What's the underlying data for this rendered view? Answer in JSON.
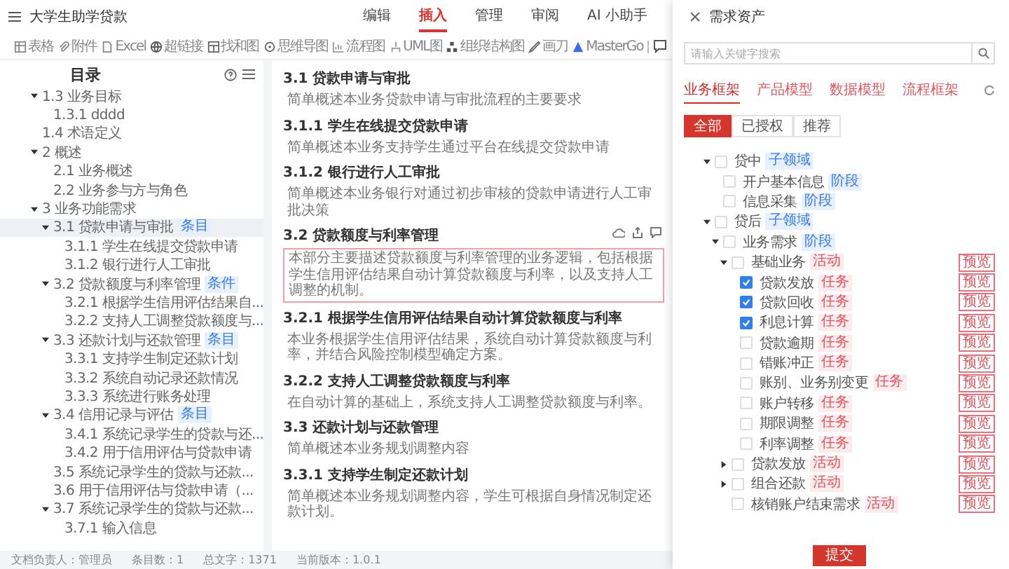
{
  "app": {
    "title": "大学生助学贷款"
  },
  "menu_tabs": [
    {
      "label": "编辑",
      "selected": false
    },
    {
      "label": "插入",
      "selected": true
    },
    {
      "label": "管理",
      "selected": false
    },
    {
      "label": "审阅",
      "selected": false
    },
    {
      "label": "AI 小助手",
      "selected": false
    }
  ],
  "toolbar": [
    {
      "kind": "table",
      "label": "表格"
    },
    {
      "kind": "attachment",
      "label": "附件"
    },
    {
      "kind": "excel",
      "label": "Excel"
    },
    {
      "kind": "link",
      "label": "超链接"
    },
    {
      "kind": "chart",
      "label": "找和图"
    },
    {
      "kind": "mindmap",
      "label": "思维导图"
    },
    {
      "kind": "flow",
      "label": "流程图"
    },
    {
      "kind": "uml",
      "label": "UML图"
    },
    {
      "kind": "org",
      "label": "组织结构图"
    },
    {
      "kind": "pen",
      "label": "画刀"
    },
    {
      "kind": "mastergo",
      "label": "MasterGo"
    }
  ],
  "outline": {
    "title": "目录",
    "items": [
      {
        "label": "1.3 业务目标",
        "expanded": true,
        "selected": false,
        "children": [
          {
            "label": "1.3.1 dddd",
            "selected": false
          }
        ]
      },
      {
        "label": "1.4 术语定义",
        "selected": false
      },
      {
        "label": "2 概述",
        "expanded": true,
        "selected": false,
        "children": [
          {
            "label": "2.1 业务概述",
            "selected": false
          },
          {
            "label": "2.2 业务参与方与角色",
            "selected": false
          }
        ]
      },
      {
        "label": "3 业务功能需求",
        "expanded": true,
        "selected": false,
        "children": [
          {
            "label": "3.1 贷款申请与审批",
            "tag": "条目",
            "expanded": true,
            "selected": true,
            "children": [
              {
                "label": "3.1.1 学生在线提交贷款申请",
                "selected": false
              },
              {
                "label": "3.1.2 银行进行人工审批",
                "selected": false
              }
            ]
          },
          {
            "label": "3.2 贷款额度与利率管理",
            "tag": "条件",
            "expanded": true,
            "selected": false,
            "children": [
              {
                "label": "3.2.1 根据学生信用评估结果自...",
                "selected": false
              },
              {
                "label": "3.2.2 支持人工调整贷款额度与...",
                "selected": false
              }
            ]
          },
          {
            "label": "3.3 还款计划与还款管理",
            "tag": "条目",
            "expanded": true,
            "selected": false,
            "children": [
              {
                "label": "3.3.1 支持学生制定还款计划",
                "selected": false
              },
              {
                "label": "3.3.2 系统自动记录还款情况",
                "selected": false
              },
              {
                "label": "3.3.3 系统进行账务处理",
                "selected": false
              }
            ]
          },
          {
            "label": "3.4 信用记录与评估",
            "tag": "条目",
            "expanded": true,
            "selected": false,
            "children": [
              {
                "label": "3.4.1 系统记录学生的贷款与还...",
                "selected": false
              },
              {
                "label": "3.4.2 用于信用评估与贷款申请",
                "selected": false
              }
            ]
          },
          {
            "label": "3.5 系统记录学生的贷款与还款...",
            "selected": false
          },
          {
            "label": "3.6 用于信用评估与贷款申请（...",
            "selected": false
          },
          {
            "label": "3.7 系统记录学生的贷款与还款...",
            "expanded": true,
            "selected": false,
            "children": [
              {
                "label": "3.7.1 输入信息",
                "selected": false
              }
            ]
          }
        ]
      }
    ]
  },
  "document": {
    "blocks": [
      {
        "kind": "heading",
        "text": "3.1 贷款申请与审批",
        "selected": false
      },
      {
        "kind": "paragraph",
        "text": "简单概述本业务贷款申请与审批流程的主要要求",
        "selected": false
      },
      {
        "kind": "heading",
        "text": "3.1.1 学生在线提交贷款申请",
        "selected": false
      },
      {
        "kind": "paragraph",
        "text": "简单概述本业务支持学生通过平台在线提交贷款申请",
        "selected": false
      },
      {
        "kind": "heading",
        "text": "3.1.2 银行进行人工审批",
        "selected": false
      },
      {
        "kind": "paragraph",
        "text": "简单概述本业务银行对通过初步审核的贷款申请进行人工审批决策",
        "selected": false
      },
      {
        "kind": "heading",
        "text": "3.2 贷款额度与利率管理",
        "selected": false
      },
      {
        "kind": "paragraph",
        "text": "本部分主要描述贷款额度与利率管理的业务逻辑，包括根据学生信用评估结果自动计算贷款额度与利率，以及支持人工调整的机制。",
        "selected": true
      },
      {
        "kind": "heading",
        "text": "3.2.1 根据学生信用评估结果自动计算贷款额度与利率",
        "selected": false
      },
      {
        "kind": "paragraph",
        "text": "本业务根据学生信用评估结果，系统自动计算贷款额度与利率，并结合风险控制模型确定方案。",
        "selected": false
      },
      {
        "kind": "heading",
        "text": "3.2.2 支持人工调整贷款额度与利率",
        "selected": false
      },
      {
        "kind": "paragraph",
        "text": "在自动计算的基础上，系统支持人工调整贷款额度与利率。",
        "selected": false
      },
      {
        "kind": "heading",
        "text": "3.3 还款计划与还款管理",
        "selected": false
      },
      {
        "kind": "paragraph",
        "text": "简单概述本业务规划调整内容",
        "selected": false
      },
      {
        "kind": "heading",
        "text": "3.3.1 支持学生制定还款计划",
        "selected": false
      },
      {
        "kind": "paragraph",
        "text": "简单概述本业务规划调整内容，学生可根据自身情况制定还款计划。",
        "selected": false
      }
    ]
  },
  "status_bar": [
    "文档负责人：管理员",
    "条目数：1",
    "总文字：1371",
    "当前版本：1.0.1"
  ],
  "asset_panel": {
    "title": "需求资产",
    "search": {
      "placeholder": "请输入关键字搜索"
    },
    "tabs": [
      {
        "label": "业务框架",
        "selected": true
      },
      {
        "label": "产品模型",
        "selected": false
      },
      {
        "label": "数据模型",
        "selected": false
      },
      {
        "label": "流程框架",
        "selected": false
      }
    ],
    "filters": [
      {
        "label": "全部",
        "selected": true
      },
      {
        "label": "已授权",
        "selected": false
      },
      {
        "label": "推荐",
        "selected": false
      }
    ],
    "tree": [
      {
        "label": "贷中",
        "kind": "subdomain",
        "tag": "子领域",
        "checked": false,
        "expanded": true,
        "children": [
          {
            "label": "开户基本信息",
            "kind": "stage",
            "tag": "阶段",
            "checked": false
          },
          {
            "label": "信息采集",
            "kind": "stage",
            "tag": "阶段",
            "checked": false
          }
        ]
      },
      {
        "label": "贷后",
        "kind": "subdomain",
        "tag": "子领域",
        "checked": false,
        "expanded": true,
        "children": [
          {
            "label": "业务需求",
            "kind": "stage",
            "tag": "阶段",
            "checked": false,
            "expanded": true,
            "children": [
              {
                "label": "基础业务",
                "kind": "activity",
                "tag": "活动",
                "action": "预览",
                "checked": false,
                "expanded": true,
                "children": [
                  {
                    "label": "贷款发放",
                    "kind": "task",
                    "tag": "任务",
                    "action": "预览",
                    "checked": true
                  },
                  {
                    "label": "贷款回收",
                    "kind": "task",
                    "tag": "任务",
                    "action": "预览",
                    "checked": true
                  },
                  {
                    "label": "利息计算",
                    "kind": "task",
                    "tag": "任务",
                    "action": "预览",
                    "checked": true
                  },
                  {
                    "label": "贷款逾期",
                    "kind": "task",
                    "tag": "任务",
                    "action": "预览",
                    "checked": false
                  },
                  {
                    "label": "错账冲正",
                    "kind": "task",
                    "tag": "任务",
                    "action": "预览",
                    "checked": false
                  },
                  {
                    "label": "账别、业务别变更",
                    "kind": "task",
                    "tag": "任务",
                    "action": "预览",
                    "checked": false
                  },
                  {
                    "label": "账户转移",
                    "kind": "task",
                    "tag": "任务",
                    "action": "预览",
                    "checked": false
                  },
                  {
                    "label": "期限调整",
                    "kind": "task",
                    "tag": "任务",
                    "action": "预览",
                    "checked": false
                  },
                  {
                    "label": "利率调整",
                    "kind": "task",
                    "tag": "任务",
                    "action": "预览",
                    "checked": false
                  }
                ]
              },
              {
                "label": "贷款发放",
                "kind": "activity",
                "tag": "活动",
                "action": "预览",
                "checked": false,
                "expanded": false
              },
              {
                "label": "组合还款",
                "kind": "activity",
                "tag": "活动",
                "action": "预览",
                "checked": false,
                "expanded": false
              },
              {
                "label": "核销账户结束需求",
                "kind": "activity",
                "tag": "活动",
                "action": "预览",
                "checked": false
              }
            ]
          }
        ]
      }
    ],
    "submit": "提交"
  }
}
